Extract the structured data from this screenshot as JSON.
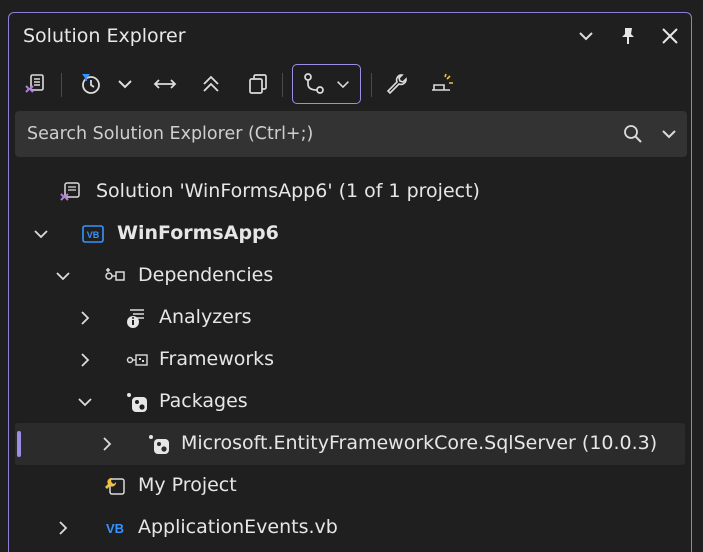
{
  "window": {
    "title": "Solution Explorer",
    "accent_color": "#8b7fd6"
  },
  "titlebar_icons": [
    "chevron-down-icon",
    "pin-icon",
    "close-icon"
  ],
  "toolbar": {
    "tools": [
      "switch-views-icon",
      "pending-changes-filter-icon",
      "dropdown-chevron-icon",
      "sync-active-document-icon",
      "collapse-all-icon",
      "show-all-files-icon",
      "track-active-item-icon",
      "dropdown-chevron-icon",
      "properties-wrench-icon",
      "preview-selected-items-icon"
    ]
  },
  "search": {
    "placeholder": "Search Solution Explorer (Ctrl+;)"
  },
  "tree": {
    "solution": "Solution 'WinFormsApp6' (1 of 1 project)",
    "project": "WinFormsApp6",
    "dependencies": "Dependencies",
    "analyzers": "Analyzers",
    "frameworks": "Frameworks",
    "packages": "Packages",
    "package_item": "Microsoft.EntityFrameworkCore.SqlServer (10.0.3)",
    "my_project": "My Project",
    "application_events": "ApplicationEvents.vb"
  }
}
